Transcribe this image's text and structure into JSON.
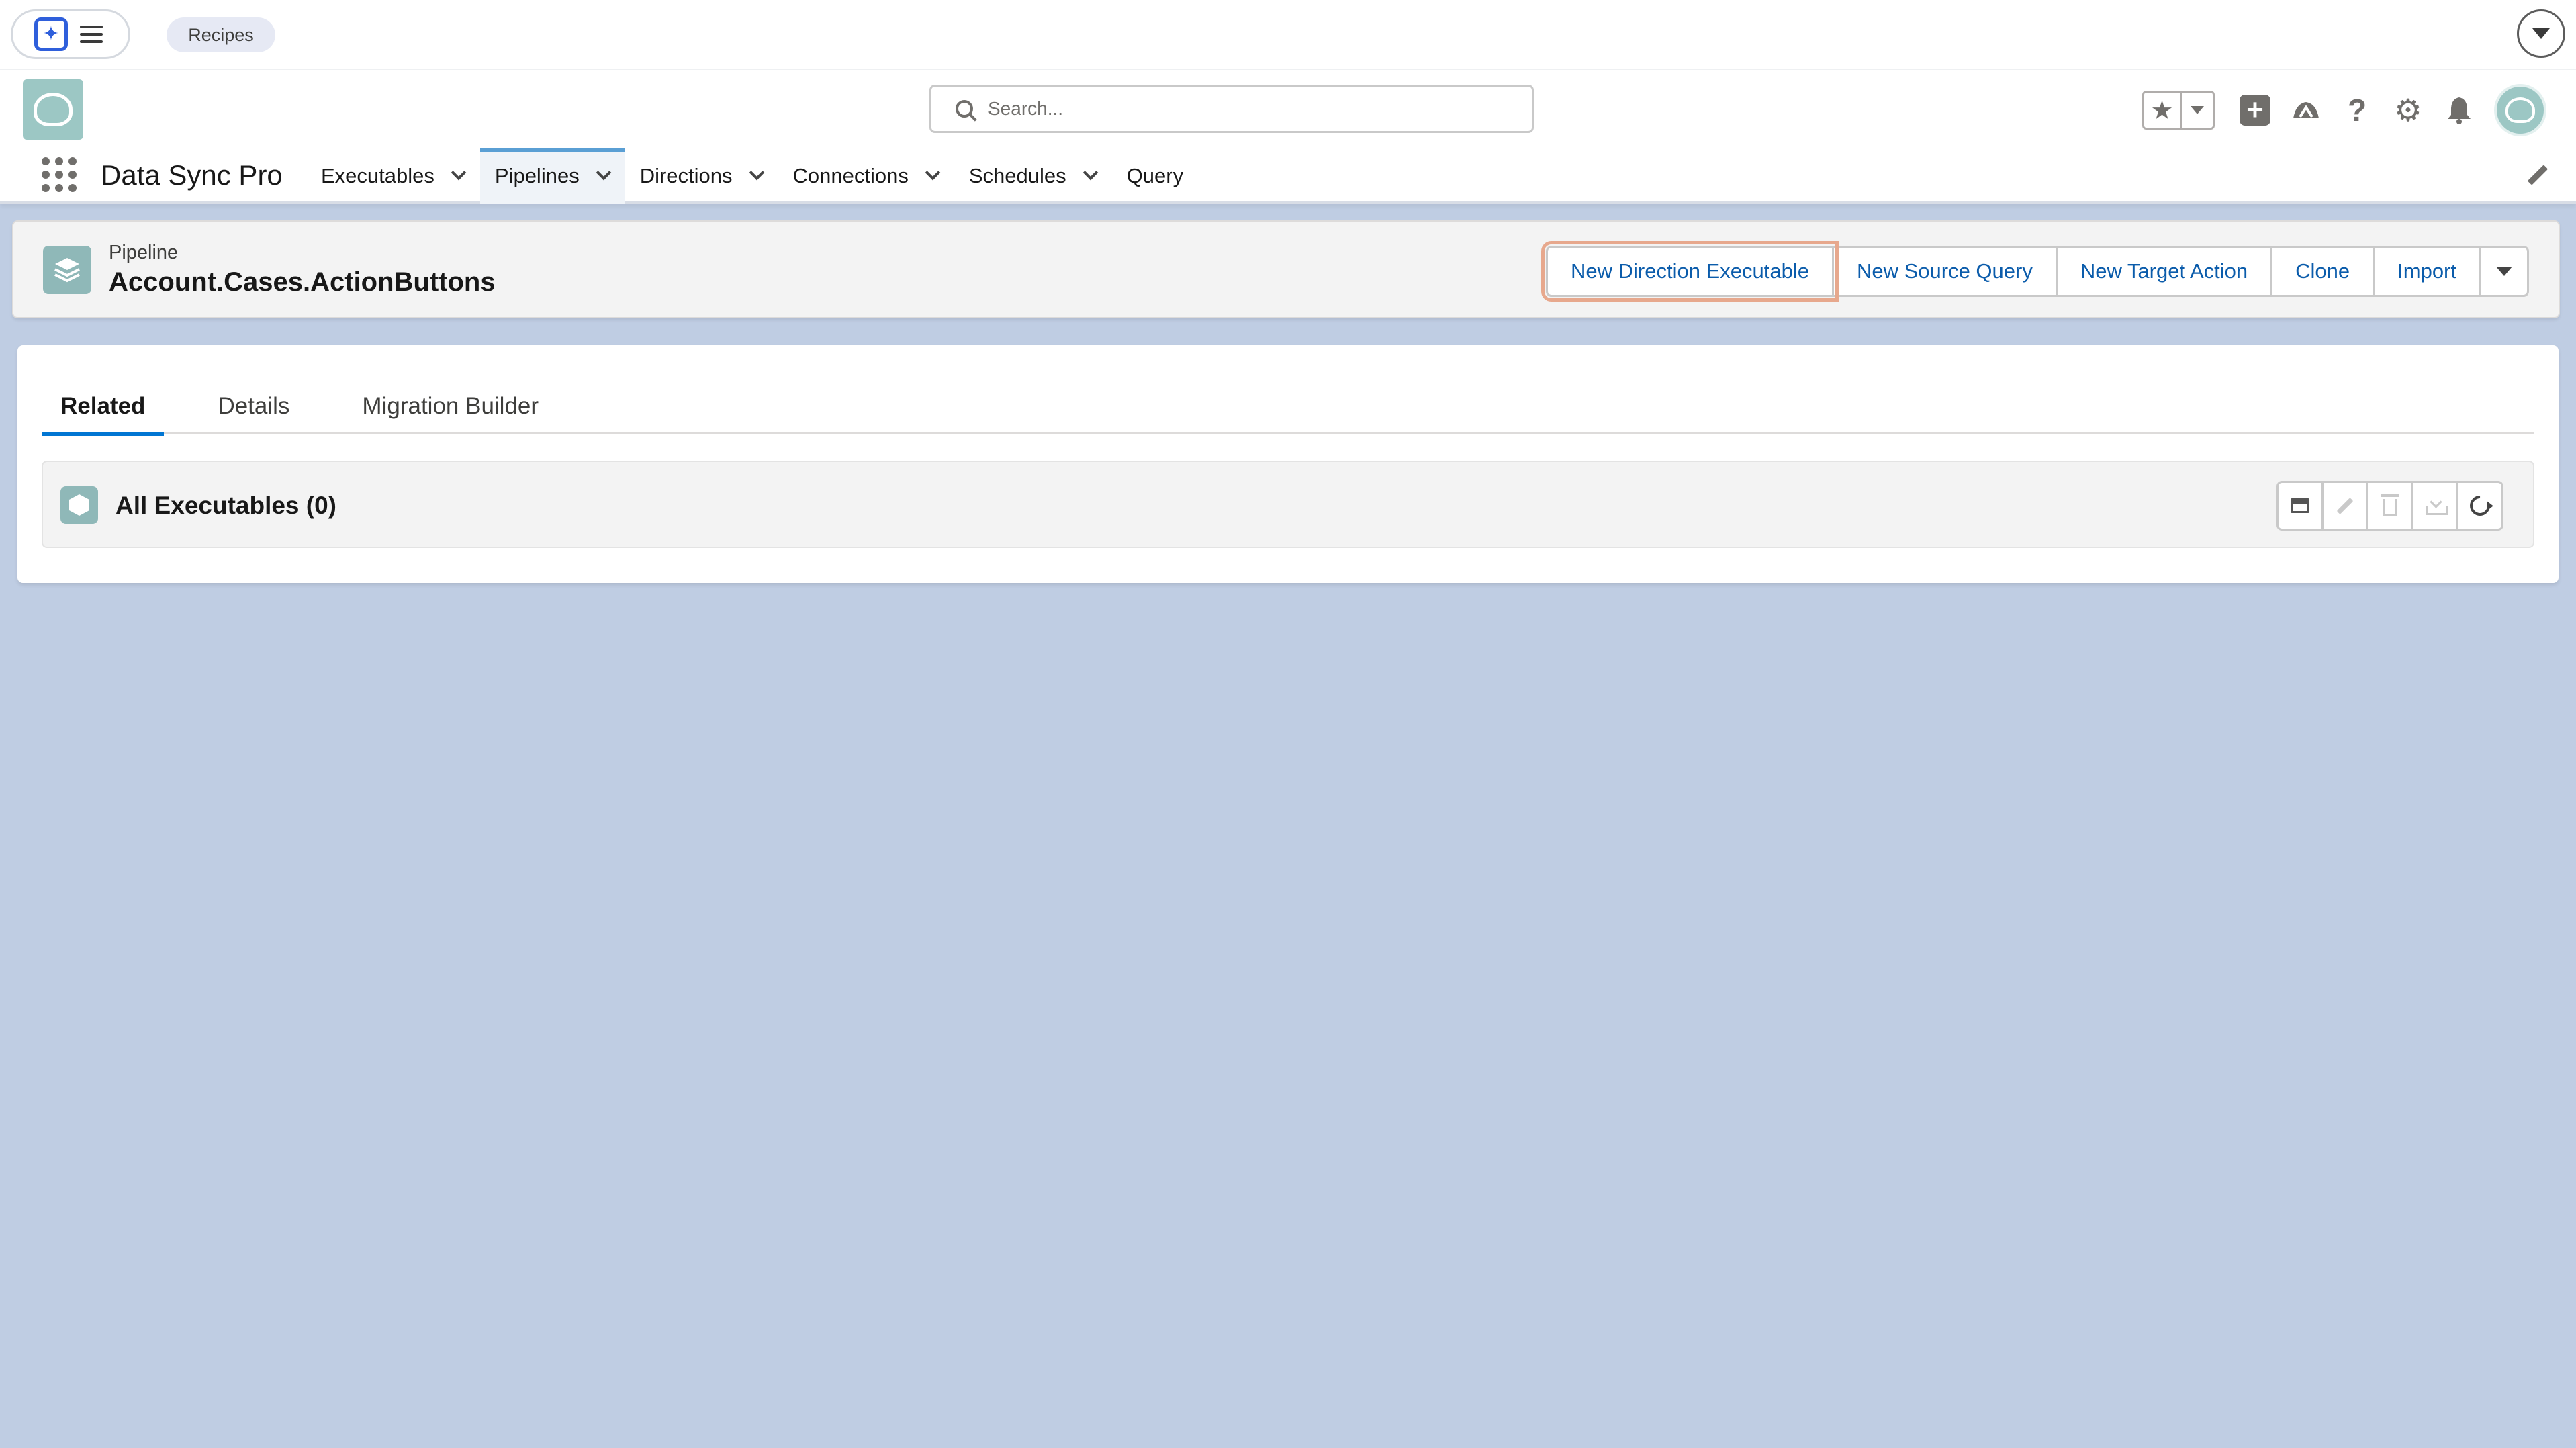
{
  "utility_bar": {
    "recipes_label": "Recipes"
  },
  "header": {
    "search_placeholder": "Search...",
    "app_name": "Data Sync Pro",
    "nav_items": [
      {
        "label": "Executables",
        "has_dropdown": true,
        "active": false
      },
      {
        "label": "Pipelines",
        "has_dropdown": true,
        "active": true
      },
      {
        "label": "Directions",
        "has_dropdown": true,
        "active": false
      },
      {
        "label": "Connections",
        "has_dropdown": true,
        "active": false
      },
      {
        "label": "Schedules",
        "has_dropdown": true,
        "active": false
      },
      {
        "label": "Query",
        "has_dropdown": false,
        "active": false
      }
    ],
    "icons": [
      "favorites-star-icon",
      "favorites-dropdown-icon",
      "global-actions-plus-icon",
      "trailhead-icon",
      "help-icon",
      "setup-gear-icon",
      "notifications-bell-icon",
      "user-avatar"
    ]
  },
  "record": {
    "type_label": "Pipeline",
    "title": "Account.Cases.ActionButtons",
    "actions": [
      "New Direction Executable",
      "New Source Query",
      "New Target Action",
      "Clone",
      "Import"
    ]
  },
  "tabs": [
    {
      "label": "Related",
      "active": true
    },
    {
      "label": "Details",
      "active": false
    },
    {
      "label": "Migration Builder",
      "active": false
    }
  ],
  "related_card": {
    "title": "All Executables (0)",
    "tools": [
      "board-icon",
      "edit-icon",
      "delete-icon",
      "download-icon",
      "refresh-icon"
    ]
  },
  "colors": {
    "page_background": "#bfcde3",
    "brand_blue": "#0b5cab",
    "active_tab_underline": "#0176d3",
    "nav_active_bar": "#5a9fd4",
    "focus_outline": "#e7a88d",
    "app_icon_teal": "#8fb8b8"
  }
}
